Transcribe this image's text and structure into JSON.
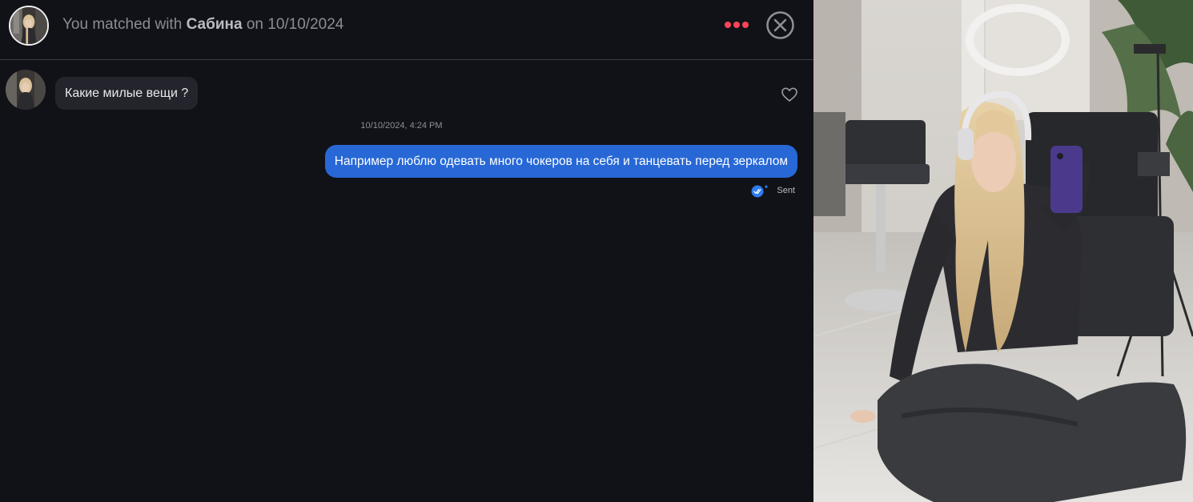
{
  "header": {
    "match_prefix": "You matched with",
    "match_name": "Сабина",
    "match_suffix": "on 10/10/2024",
    "more_icon": "more-dots-icon",
    "close_icon": "close-circle-icon"
  },
  "messages": {
    "incoming_text": "Какие милые вещи ?",
    "timestamp": "10/10/2024, 4:24 PM",
    "outgoing_text": "Например люблю одевать много чокеров на себя и танцевать перед зеркалом",
    "status_label": "Sent"
  },
  "icons": {
    "like": "heart-icon",
    "status": "double-check-icon"
  },
  "colors": {
    "background": "#111217",
    "incoming_bubble": "#24252c",
    "outgoing_bubble": "#2768d6",
    "more_dots": "#ff4458",
    "divider": "#3c3f46"
  }
}
